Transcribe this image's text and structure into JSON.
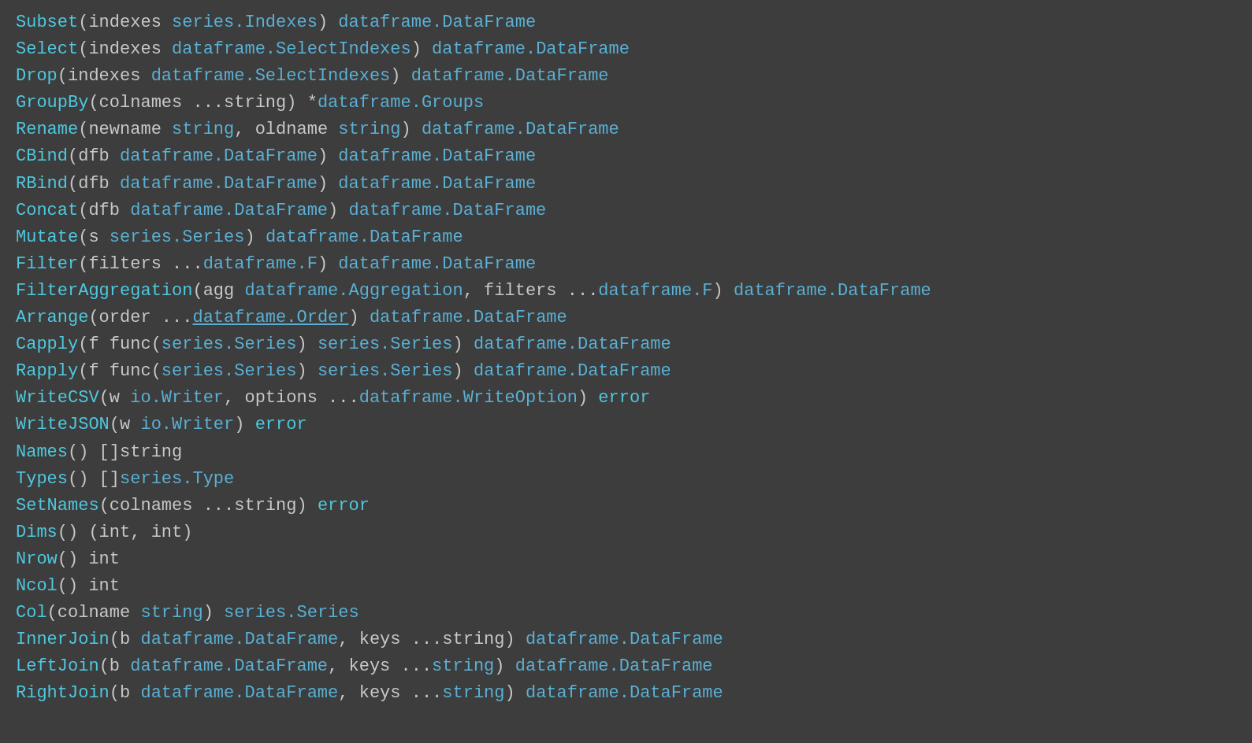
{
  "lines": [
    {
      "id": "line-subset",
      "parts": [
        {
          "text": "Subset",
          "class": "cyan"
        },
        {
          "text": "(indexes ",
          "class": "light-gray"
        },
        {
          "text": "series.Indexes",
          "class": "blue-type"
        },
        {
          "text": ") ",
          "class": "light-gray"
        },
        {
          "text": "dataframe.DataFrame",
          "class": "blue-type"
        }
      ]
    },
    {
      "id": "line-select",
      "parts": [
        {
          "text": "Select",
          "class": "cyan"
        },
        {
          "text": "(indexes ",
          "class": "light-gray"
        },
        {
          "text": "dataframe.SelectIndexes",
          "class": "blue-type"
        },
        {
          "text": ") ",
          "class": "light-gray"
        },
        {
          "text": "dataframe.DataFrame",
          "class": "blue-type"
        }
      ]
    },
    {
      "id": "line-drop",
      "parts": [
        {
          "text": "Drop",
          "class": "cyan"
        },
        {
          "text": "(indexes ",
          "class": "light-gray"
        },
        {
          "text": "dataframe.SelectIndexes",
          "class": "blue-type"
        },
        {
          "text": ") ",
          "class": "light-gray"
        },
        {
          "text": "dataframe.DataFrame",
          "class": "blue-type"
        }
      ]
    },
    {
      "id": "line-groupby",
      "parts": [
        {
          "text": "GroupBy",
          "class": "cyan"
        },
        {
          "text": "(colnames ...string) *",
          "class": "light-gray"
        },
        {
          "text": "dataframe.Groups",
          "class": "blue-type"
        }
      ]
    },
    {
      "id": "line-rename",
      "parts": [
        {
          "text": "Rename",
          "class": "cyan"
        },
        {
          "text": "(newname ",
          "class": "light-gray"
        },
        {
          "text": "string",
          "class": "blue-type"
        },
        {
          "text": ", oldname ",
          "class": "light-gray"
        },
        {
          "text": "string",
          "class": "blue-type"
        },
        {
          "text": ") ",
          "class": "light-gray"
        },
        {
          "text": "dataframe.DataFrame",
          "class": "blue-type"
        }
      ]
    },
    {
      "id": "line-cbind",
      "parts": [
        {
          "text": "CBind",
          "class": "cyan"
        },
        {
          "text": "(dfb ",
          "class": "light-gray"
        },
        {
          "text": "dataframe.DataFrame",
          "class": "blue-type"
        },
        {
          "text": ") ",
          "class": "light-gray"
        },
        {
          "text": "dataframe.DataFrame",
          "class": "blue-type"
        }
      ]
    },
    {
      "id": "line-rbind",
      "parts": [
        {
          "text": "RBind",
          "class": "cyan"
        },
        {
          "text": "(dfb ",
          "class": "light-gray"
        },
        {
          "text": "dataframe.DataFrame",
          "class": "blue-type"
        },
        {
          "text": ") ",
          "class": "light-gray"
        },
        {
          "text": "dataframe.DataFrame",
          "class": "blue-type"
        }
      ]
    },
    {
      "id": "line-concat",
      "parts": [
        {
          "text": "Concat",
          "class": "cyan"
        },
        {
          "text": "(dfb ",
          "class": "light-gray"
        },
        {
          "text": "dataframe.DataFrame",
          "class": "blue-type"
        },
        {
          "text": ") ",
          "class": "light-gray"
        },
        {
          "text": "dataframe.DataFrame",
          "class": "blue-type"
        }
      ]
    },
    {
      "id": "line-mutate",
      "parts": [
        {
          "text": "Mutate",
          "class": "cyan"
        },
        {
          "text": "(s ",
          "class": "light-gray"
        },
        {
          "text": "series.Series",
          "class": "blue-type"
        },
        {
          "text": ") ",
          "class": "light-gray"
        },
        {
          "text": "dataframe.DataFrame",
          "class": "blue-type"
        }
      ]
    },
    {
      "id": "line-filter",
      "parts": [
        {
          "text": "Filter",
          "class": "cyan"
        },
        {
          "text": "(filters ...",
          "class": "light-gray"
        },
        {
          "text": "dataframe.F",
          "class": "blue-type"
        },
        {
          "text": ") ",
          "class": "light-gray"
        },
        {
          "text": "dataframe.DataFrame",
          "class": "blue-type"
        }
      ]
    },
    {
      "id": "line-filteragg",
      "parts": [
        {
          "text": "FilterAggregation",
          "class": "cyan"
        },
        {
          "text": "(agg ",
          "class": "light-gray"
        },
        {
          "text": "dataframe.Aggregation",
          "class": "blue-type"
        },
        {
          "text": ", filters ...",
          "class": "light-gray"
        },
        {
          "text": "dataframe.F",
          "class": "blue-type"
        },
        {
          "text": ") ",
          "class": "light-gray"
        },
        {
          "text": "dataframe.DataFrame",
          "class": "blue-type"
        }
      ]
    },
    {
      "id": "line-arrange",
      "parts": [
        {
          "text": "Arrange",
          "class": "cyan"
        },
        {
          "text": "(order ...",
          "class": "light-gray"
        },
        {
          "text": "dataframe.Order",
          "class": "blue-type underline"
        },
        {
          "text": ") ",
          "class": "light-gray"
        },
        {
          "text": "dataframe.DataFrame",
          "class": "blue-type"
        }
      ]
    },
    {
      "id": "line-capply",
      "parts": [
        {
          "text": "Capply",
          "class": "cyan"
        },
        {
          "text": "(f func(",
          "class": "light-gray"
        },
        {
          "text": "series.Series",
          "class": "blue-type"
        },
        {
          "text": ") ",
          "class": "light-gray"
        },
        {
          "text": "series.Series",
          "class": "blue-type"
        },
        {
          "text": ") ",
          "class": "light-gray"
        },
        {
          "text": "dataframe.DataFrame",
          "class": "blue-type"
        }
      ]
    },
    {
      "id": "line-rapply",
      "parts": [
        {
          "text": "Rapply",
          "class": "cyan"
        },
        {
          "text": "(f func(",
          "class": "light-gray"
        },
        {
          "text": "series.Series",
          "class": "blue-type"
        },
        {
          "text": ") ",
          "class": "light-gray"
        },
        {
          "text": "series.Series",
          "class": "blue-type"
        },
        {
          "text": ") ",
          "class": "light-gray"
        },
        {
          "text": "dataframe.DataFrame",
          "class": "blue-type"
        }
      ]
    },
    {
      "id": "line-writecsv",
      "parts": [
        {
          "text": "WriteCSV",
          "class": "cyan"
        },
        {
          "text": "(w ",
          "class": "light-gray"
        },
        {
          "text": "io.Writer",
          "class": "blue-type"
        },
        {
          "text": ", options ...",
          "class": "light-gray"
        },
        {
          "text": "dataframe.WriteOption",
          "class": "blue-type"
        },
        {
          "text": ") ",
          "class": "light-gray"
        },
        {
          "text": "error",
          "class": "cyan"
        }
      ]
    },
    {
      "id": "line-writejson",
      "parts": [
        {
          "text": "WriteJSON",
          "class": "cyan"
        },
        {
          "text": "(w ",
          "class": "light-gray"
        },
        {
          "text": "io.Writer",
          "class": "blue-type"
        },
        {
          "text": ") ",
          "class": "light-gray"
        },
        {
          "text": "error",
          "class": "cyan"
        }
      ]
    },
    {
      "id": "line-names",
      "parts": [
        {
          "text": "Names",
          "class": "cyan"
        },
        {
          "text": "() []string",
          "class": "light-gray"
        }
      ]
    },
    {
      "id": "line-types",
      "parts": [
        {
          "text": "Types",
          "class": "cyan"
        },
        {
          "text": "() []",
          "class": "light-gray"
        },
        {
          "text": "series.Type",
          "class": "blue-type"
        }
      ]
    },
    {
      "id": "line-setnames",
      "parts": [
        {
          "text": "SetNames",
          "class": "cyan"
        },
        {
          "text": "(colnames ...string) ",
          "class": "light-gray"
        },
        {
          "text": "error",
          "class": "cyan"
        }
      ]
    },
    {
      "id": "line-dims",
      "parts": [
        {
          "text": "Dims",
          "class": "cyan"
        },
        {
          "text": "() (int, int)",
          "class": "light-gray"
        }
      ]
    },
    {
      "id": "line-nrow",
      "parts": [
        {
          "text": "Nrow",
          "class": "cyan"
        },
        {
          "text": "() int",
          "class": "light-gray"
        }
      ]
    },
    {
      "id": "line-ncol",
      "parts": [
        {
          "text": "Ncol",
          "class": "cyan"
        },
        {
          "text": "() int",
          "class": "light-gray"
        }
      ]
    },
    {
      "id": "line-col",
      "parts": [
        {
          "text": "Col",
          "class": "cyan"
        },
        {
          "text": "(colname ",
          "class": "light-gray"
        },
        {
          "text": "string",
          "class": "blue-type"
        },
        {
          "text": ") ",
          "class": "light-gray"
        },
        {
          "text": "series.Series",
          "class": "blue-type"
        }
      ]
    },
    {
      "id": "line-innerjoin",
      "parts": [
        {
          "text": "InnerJoin",
          "class": "cyan"
        },
        {
          "text": "(b ",
          "class": "light-gray"
        },
        {
          "text": "dataframe.DataFrame",
          "class": "blue-type"
        },
        {
          "text": ", keys ...string) ",
          "class": "light-gray"
        },
        {
          "text": "dataframe.DataFrame",
          "class": "blue-type"
        }
      ]
    },
    {
      "id": "line-leftjoin",
      "parts": [
        {
          "text": "LeftJoin",
          "class": "cyan"
        },
        {
          "text": "(b ",
          "class": "light-gray"
        },
        {
          "text": "dataframe.DataFrame",
          "class": "blue-type"
        },
        {
          "text": ", keys ...",
          "class": "light-gray"
        },
        {
          "text": "string",
          "class": "blue-type"
        },
        {
          "text": ") ",
          "class": "light-gray"
        },
        {
          "text": "dataframe.DataFrame",
          "class": "blue-type"
        }
      ]
    },
    {
      "id": "line-rightjoin",
      "parts": [
        {
          "text": "RightJoin",
          "class": "cyan"
        },
        {
          "text": "(b ",
          "class": "light-gray"
        },
        {
          "text": "dataframe.DataFrame",
          "class": "blue-type"
        },
        {
          "text": ", keys ...",
          "class": "light-gray"
        },
        {
          "text": "string",
          "class": "blue-type"
        },
        {
          "text": ") ",
          "class": "light-gray"
        },
        {
          "text": "dataframe.DataFrame",
          "class": "blue-type"
        }
      ]
    }
  ]
}
